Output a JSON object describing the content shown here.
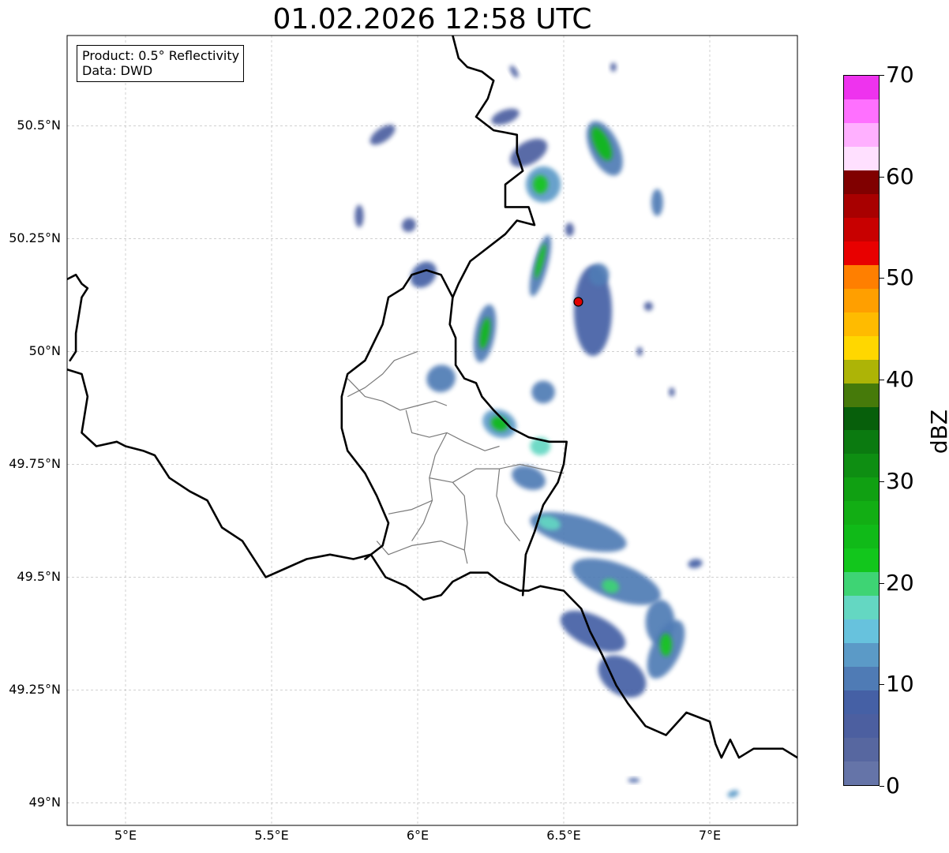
{
  "title": "01.02.2026 12:58 UTC",
  "info": {
    "product": "Product: 0.5° Reflectivity",
    "data": "Data: DWD"
  },
  "map": {
    "lon_range": [
      4.8,
      7.3
    ],
    "lat_range": [
      48.95,
      50.7
    ],
    "x_ticks": [
      {
        "lon": 5.0,
        "label": "5°E"
      },
      {
        "lon": 5.5,
        "label": "5.5°E"
      },
      {
        "lon": 6.0,
        "label": "6°E"
      },
      {
        "lon": 6.5,
        "label": "6.5°E"
      },
      {
        "lon": 7.0,
        "label": "7°E"
      }
    ],
    "y_ticks": [
      {
        "lat": 49.0,
        "label": "49°N"
      },
      {
        "lat": 49.25,
        "label": "49.25°N"
      },
      {
        "lat": 49.5,
        "label": "49.5°N"
      },
      {
        "lat": 49.75,
        "label": "49.75°N"
      },
      {
        "lat": 50.0,
        "label": "50°N"
      },
      {
        "lat": 50.25,
        "label": "50.25°N"
      },
      {
        "lat": 50.5,
        "label": "50.5°N"
      }
    ],
    "gridlines": true,
    "radar_site": {
      "lon": 6.55,
      "lat": 50.11,
      "color": "#e00000"
    },
    "borders": [
      [
        [
          4.8,
          50.16
        ],
        [
          4.83,
          50.17
        ],
        [
          4.85,
          50.15
        ],
        [
          4.87,
          50.14
        ],
        [
          4.85,
          50.12
        ],
        [
          4.84,
          50.08
        ],
        [
          4.83,
          50.04
        ],
        [
          4.83,
          50.0
        ],
        [
          4.81,
          49.98
        ]
      ],
      [
        [
          4.8,
          49.96
        ],
        [
          4.85,
          49.95
        ],
        [
          4.87,
          49.9
        ],
        [
          4.85,
          49.82
        ],
        [
          4.9,
          49.79
        ],
        [
          4.97,
          49.8
        ],
        [
          5.0,
          49.79
        ],
        [
          5.06,
          49.78
        ],
        [
          5.1,
          49.77
        ],
        [
          5.15,
          49.72
        ],
        [
          5.22,
          49.69
        ],
        [
          5.28,
          49.67
        ],
        [
          5.33,
          49.61
        ],
        [
          5.4,
          49.58
        ],
        [
          5.45,
          49.53
        ],
        [
          5.48,
          49.5
        ],
        [
          5.55,
          49.52
        ],
        [
          5.62,
          49.54
        ],
        [
          5.7,
          49.55
        ],
        [
          5.78,
          49.54
        ],
        [
          5.84,
          49.55
        ],
        [
          5.89,
          49.5
        ],
        [
          5.96,
          49.48
        ],
        [
          6.02,
          49.45
        ],
        [
          6.08,
          49.46
        ],
        [
          6.12,
          49.49
        ],
        [
          6.18,
          49.51
        ],
        [
          6.24,
          49.51
        ],
        [
          6.28,
          49.49
        ],
        [
          6.35,
          49.47
        ],
        [
          6.38,
          49.47
        ],
        [
          6.42,
          49.48
        ],
        [
          6.5,
          49.47
        ],
        [
          6.56,
          49.43
        ],
        [
          6.59,
          49.38
        ],
        [
          6.63,
          49.33
        ],
        [
          6.68,
          49.26
        ],
        [
          6.72,
          49.22
        ],
        [
          6.78,
          49.17
        ],
        [
          6.85,
          49.15
        ],
        [
          6.92,
          49.2
        ],
        [
          7.0,
          49.18
        ],
        [
          7.02,
          49.13
        ],
        [
          7.04,
          49.1
        ],
        [
          7.07,
          49.14
        ],
        [
          7.1,
          49.1
        ],
        [
          7.15,
          49.12
        ],
        [
          7.2,
          49.12
        ],
        [
          7.25,
          49.12
        ],
        [
          7.3,
          49.1
        ]
      ],
      [
        [
          6.12,
          50.7
        ],
        [
          6.14,
          50.65
        ],
        [
          6.17,
          50.63
        ],
        [
          6.22,
          50.62
        ],
        [
          6.26,
          50.6
        ],
        [
          6.24,
          50.56
        ],
        [
          6.2,
          50.52
        ],
        [
          6.26,
          50.49
        ],
        [
          6.34,
          50.48
        ],
        [
          6.34,
          50.44
        ],
        [
          6.36,
          50.4
        ],
        [
          6.3,
          50.37
        ],
        [
          6.3,
          50.32
        ],
        [
          6.38,
          50.32
        ],
        [
          6.4,
          50.28
        ],
        [
          6.34,
          50.29
        ],
        [
          6.3,
          50.26
        ],
        [
          6.22,
          50.22
        ],
        [
          6.18,
          50.2
        ],
        [
          6.14,
          50.15
        ],
        [
          6.12,
          50.12
        ],
        [
          6.11,
          50.06
        ],
        [
          6.13,
          50.03
        ],
        [
          6.13,
          49.97
        ],
        [
          6.16,
          49.94
        ],
        [
          6.2,
          49.93
        ],
        [
          6.22,
          49.9
        ],
        [
          6.26,
          49.87
        ],
        [
          6.32,
          49.83
        ],
        [
          6.38,
          49.81
        ],
        [
          6.45,
          49.8
        ],
        [
          6.51,
          49.8
        ],
        [
          6.5,
          49.75
        ],
        [
          6.48,
          49.71
        ],
        [
          6.43,
          49.66
        ],
        [
          6.4,
          49.6
        ],
        [
          6.37,
          49.55
        ],
        [
          6.36,
          49.46
        ]
      ],
      [
        [
          6.12,
          50.12
        ],
        [
          6.08,
          50.17
        ],
        [
          6.03,
          50.18
        ],
        [
          5.98,
          50.17
        ],
        [
          5.95,
          50.14
        ],
        [
          5.9,
          50.12
        ],
        [
          5.88,
          50.06
        ],
        [
          5.85,
          50.02
        ],
        [
          5.82,
          49.98
        ],
        [
          5.76,
          49.95
        ],
        [
          5.74,
          49.9
        ],
        [
          5.74,
          49.83
        ],
        [
          5.76,
          49.78
        ],
        [
          5.82,
          49.73
        ],
        [
          5.86,
          49.68
        ],
        [
          5.9,
          49.62
        ],
        [
          5.88,
          49.57
        ],
        [
          5.82,
          49.54
        ]
      ]
    ],
    "province_lines": [
      [
        [
          5.76,
          49.9
        ],
        [
          5.82,
          49.92
        ],
        [
          5.88,
          49.95
        ],
        [
          5.92,
          49.98
        ],
        [
          6.0,
          50.0
        ]
      ],
      [
        [
          5.76,
          49.94
        ],
        [
          5.82,
          49.9
        ],
        [
          5.88,
          49.89
        ],
        [
          5.94,
          49.87
        ],
        [
          6.0,
          49.88
        ],
        [
          6.06,
          49.89
        ],
        [
          6.1,
          49.88
        ]
      ],
      [
        [
          5.96,
          49.87
        ],
        [
          5.98,
          49.82
        ],
        [
          6.04,
          49.81
        ],
        [
          6.1,
          49.82
        ],
        [
          6.16,
          49.8
        ],
        [
          6.23,
          49.78
        ],
        [
          6.28,
          49.79
        ]
      ],
      [
        [
          6.1,
          49.82
        ],
        [
          6.06,
          49.77
        ],
        [
          6.04,
          49.72
        ],
        [
          6.05,
          49.67
        ],
        [
          6.02,
          49.62
        ],
        [
          5.98,
          49.58
        ]
      ],
      [
        [
          6.04,
          49.72
        ],
        [
          6.12,
          49.71
        ],
        [
          6.2,
          49.74
        ],
        [
          6.28,
          49.74
        ],
        [
          6.35,
          49.75
        ],
        [
          6.42,
          49.74
        ],
        [
          6.5,
          49.73
        ]
      ],
      [
        [
          6.12,
          49.71
        ],
        [
          6.16,
          49.68
        ],
        [
          6.17,
          49.62
        ],
        [
          6.16,
          49.56
        ],
        [
          6.17,
          49.53
        ]
      ],
      [
        [
          5.9,
          49.64
        ],
        [
          5.98,
          49.65
        ],
        [
          6.05,
          49.67
        ]
      ],
      [
        [
          5.86,
          49.58
        ],
        [
          5.9,
          49.55
        ],
        [
          5.98,
          49.57
        ],
        [
          6.08,
          49.58
        ],
        [
          6.16,
          49.56
        ]
      ],
      [
        [
          6.28,
          49.74
        ],
        [
          6.27,
          49.68
        ],
        [
          6.3,
          49.62
        ],
        [
          6.35,
          49.58
        ]
      ]
    ],
    "echoes": [
      {
        "lon": 6.64,
        "lat": 50.45,
        "w": 0.1,
        "h": 0.13,
        "dbz": 10,
        "rot": -25
      },
      {
        "lon": 6.63,
        "lat": 50.46,
        "w": 0.05,
        "h": 0.08,
        "dbz": 25,
        "rot": -25
      },
      {
        "lon": 6.82,
        "lat": 50.33,
        "w": 0.04,
        "h": 0.06,
        "dbz": 12,
        "rot": 0
      },
      {
        "lon": 6.43,
        "lat": 50.37,
        "w": 0.12,
        "h": 0.08,
        "dbz": 14,
        "rot": 0
      },
      {
        "lon": 6.42,
        "lat": 50.37,
        "w": 0.05,
        "h": 0.04,
        "dbz": 24,
        "rot": 0
      },
      {
        "lon": 6.38,
        "lat": 50.44,
        "w": 0.14,
        "h": 0.05,
        "dbz": 6,
        "rot": -30
      },
      {
        "lon": 6.3,
        "lat": 50.52,
        "w": 0.1,
        "h": 0.03,
        "dbz": 6,
        "rot": -20
      },
      {
        "lon": 6.42,
        "lat": 50.19,
        "w": 0.05,
        "h": 0.14,
        "dbz": 12,
        "rot": 15
      },
      {
        "lon": 6.42,
        "lat": 50.2,
        "w": 0.02,
        "h": 0.08,
        "dbz": 24,
        "rot": 15
      },
      {
        "lon": 6.6,
        "lat": 50.09,
        "w": 0.13,
        "h": 0.2,
        "dbz": 8,
        "rot": 0
      },
      {
        "lon": 6.62,
        "lat": 50.17,
        "w": 0.07,
        "h": 0.05,
        "dbz": 12,
        "rot": 0
      },
      {
        "lon": 6.23,
        "lat": 50.04,
        "w": 0.07,
        "h": 0.13,
        "dbz": 12,
        "rot": 10
      },
      {
        "lon": 6.23,
        "lat": 50.04,
        "w": 0.03,
        "h": 0.07,
        "dbz": 26,
        "rot": 10
      },
      {
        "lon": 6.08,
        "lat": 49.94,
        "w": 0.1,
        "h": 0.06,
        "dbz": 10,
        "rot": -20
      },
      {
        "lon": 6.28,
        "lat": 49.84,
        "w": 0.12,
        "h": 0.06,
        "dbz": 14,
        "rot": 25
      },
      {
        "lon": 6.28,
        "lat": 49.84,
        "w": 0.06,
        "h": 0.03,
        "dbz": 26,
        "rot": 25
      },
      {
        "lon": 6.43,
        "lat": 49.91,
        "w": 0.08,
        "h": 0.05,
        "dbz": 12,
        "rot": 0
      },
      {
        "lon": 6.42,
        "lat": 49.79,
        "w": 0.07,
        "h": 0.04,
        "dbz": 18,
        "rot": 0
      },
      {
        "lon": 5.88,
        "lat": 50.48,
        "w": 0.1,
        "h": 0.03,
        "dbz": 6,
        "rot": -35
      },
      {
        "lon": 5.97,
        "lat": 50.28,
        "w": 0.05,
        "h": 0.03,
        "dbz": 6,
        "rot": -40
      },
      {
        "lon": 5.8,
        "lat": 50.3,
        "w": 0.03,
        "h": 0.05,
        "dbz": 6,
        "rot": 0
      },
      {
        "lon": 6.02,
        "lat": 50.17,
        "w": 0.1,
        "h": 0.05,
        "dbz": 8,
        "rot": -45
      },
      {
        "lon": 6.55,
        "lat": 49.6,
        "w": 0.34,
        "h": 0.07,
        "dbz": 10,
        "rot": 15
      },
      {
        "lon": 6.45,
        "lat": 49.62,
        "w": 0.08,
        "h": 0.03,
        "dbz": 18,
        "rot": 15
      },
      {
        "lon": 6.68,
        "lat": 49.49,
        "w": 0.32,
        "h": 0.08,
        "dbz": 10,
        "rot": 20
      },
      {
        "lon": 6.66,
        "lat": 49.48,
        "w": 0.06,
        "h": 0.03,
        "dbz": 22,
        "rot": 20
      },
      {
        "lon": 6.6,
        "lat": 49.38,
        "w": 0.24,
        "h": 0.07,
        "dbz": 8,
        "rot": 25
      },
      {
        "lon": 6.7,
        "lat": 49.28,
        "w": 0.18,
        "h": 0.08,
        "dbz": 8,
        "rot": 35
      },
      {
        "lon": 6.83,
        "lat": 49.4,
        "w": 0.1,
        "h": 0.1,
        "dbz": 10,
        "rot": 0
      },
      {
        "lon": 6.85,
        "lat": 49.34,
        "w": 0.1,
        "h": 0.14,
        "dbz": 12,
        "rot": 25
      },
      {
        "lon": 6.85,
        "lat": 49.35,
        "w": 0.04,
        "h": 0.05,
        "dbz": 24,
        "rot": 0
      },
      {
        "lon": 6.38,
        "lat": 49.72,
        "w": 0.12,
        "h": 0.05,
        "dbz": 12,
        "rot": 20
      },
      {
        "lon": 6.95,
        "lat": 49.53,
        "w": 0.05,
        "h": 0.02,
        "dbz": 8,
        "rot": -10
      },
      {
        "lon": 6.74,
        "lat": 49.05,
        "w": 0.04,
        "h": 0.01,
        "dbz": 8,
        "rot": 0
      },
      {
        "lon": 7.08,
        "lat": 49.02,
        "w": 0.04,
        "h": 0.015,
        "dbz": 14,
        "rot": -20
      },
      {
        "lon": 6.79,
        "lat": 50.1,
        "w": 0.03,
        "h": 0.02,
        "dbz": 6,
        "rot": 0
      },
      {
        "lon": 6.76,
        "lat": 50.0,
        "w": 0.02,
        "h": 0.02,
        "dbz": 6,
        "rot": 0
      },
      {
        "lon": 6.67,
        "lat": 50.63,
        "w": 0.02,
        "h": 0.02,
        "dbz": 6,
        "rot": 0
      },
      {
        "lon": 6.33,
        "lat": 50.62,
        "w": 0.02,
        "h": 0.03,
        "dbz": 6,
        "rot": -30
      },
      {
        "lon": 6.52,
        "lat": 50.27,
        "w": 0.03,
        "h": 0.03,
        "dbz": 6,
        "rot": 0
      },
      {
        "lon": 6.87,
        "lat": 49.91,
        "w": 0.02,
        "h": 0.02,
        "dbz": 6,
        "rot": 0
      }
    ]
  },
  "colorbar": {
    "label": "dBZ",
    "min": 0,
    "max": 70,
    "step": 2.5,
    "ticks": [
      "0",
      "10",
      "20",
      "30",
      "40",
      "50",
      "60",
      "70"
    ],
    "colors": [
      "#6574a8",
      "#5767a0",
      "#4c5fa0",
      "#4560a5",
      "#4f7bb5",
      "#5b9ac7",
      "#67c2dd",
      "#64d7c2",
      "#3ed474",
      "#12c61c",
      "#10ba18",
      "#12ae14",
      "#10a012",
      "#0e8e12",
      "#0b7a10",
      "#075f0b",
      "#467a0a",
      "#adb406",
      "#ffd700",
      "#ffbb00",
      "#ff9f00",
      "#ff7f00",
      "#e80000",
      "#c80000",
      "#a80000",
      "#800000",
      "#ffe0ff",
      "#ffb0ff",
      "#ff70ff",
      "#ee33ee"
    ]
  }
}
